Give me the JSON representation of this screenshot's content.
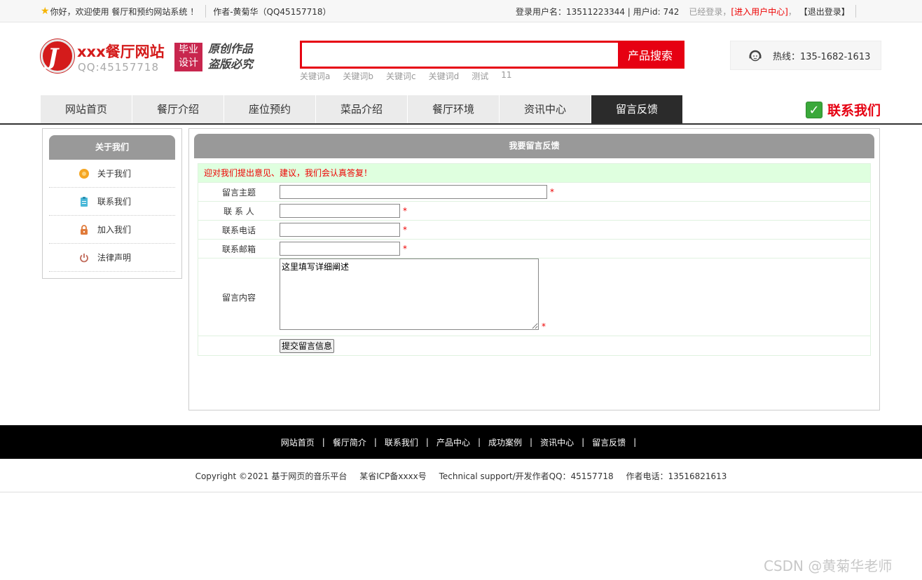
{
  "topbar": {
    "welcome": "你好，欢迎使用 餐厅和预约网站系统 ！",
    "author": "作者-黄菊华（QQ45157718）",
    "login_info": "登录用户名：13511223344 | 用户id: 742",
    "logged_in": "已经登录，",
    "user_center": "[进入用户中心]",
    "comma": "，",
    "logout": "【退出登录】"
  },
  "header": {
    "logo_letter": "J",
    "site_title": "xxx餐厅网站",
    "site_qq": "QQ:45157718",
    "grad_line1": "毕业",
    "grad_line2": "设计",
    "slogan_line1": "原创作品",
    "slogan_line2": "盗版必究",
    "search": {
      "value": "",
      "button": "产品搜索"
    },
    "keywords": [
      "关键词a",
      "关键词b",
      "关键词c",
      "关键词d",
      "测试",
      "11"
    ],
    "hotline": "热线：135-1682-1613"
  },
  "nav": {
    "items": [
      "网站首页",
      "餐厅介绍",
      "座位预约",
      "菜品介绍",
      "餐厅环境",
      "资讯中心",
      "留言反馈"
    ],
    "active_index": 6,
    "contact": "联系我们"
  },
  "sidebar": {
    "title": "关于我们",
    "items": [
      {
        "label": "关于我们",
        "icon": "orange-circle-icon"
      },
      {
        "label": "联系我们",
        "icon": "clipboard-icon"
      },
      {
        "label": "加入我们",
        "icon": "lock-icon"
      },
      {
        "label": "法律声明",
        "icon": "power-icon"
      }
    ]
  },
  "feedback": {
    "title": "我要留言反馈",
    "notice": "迎对我们提出意见、建议，我们会认真答复！",
    "subject_label": "留言主题",
    "contact_label": "联 系 人",
    "phone_label": "联系电话",
    "email_label": "联系邮箱",
    "content_label": "留言内容",
    "content_value": "这里填写详细阐述",
    "required_mark": "*",
    "submit": "提交留言信息"
  },
  "footer": {
    "links": [
      "网站首页",
      "餐厅简介",
      "联系我们",
      "产品中心",
      "成功案例",
      "资讯中心",
      "留言反馈"
    ],
    "separator": "|",
    "copyright": "Copyright ©2021 基于网页的音乐平台",
    "icp": "某省ICP备xxxx号",
    "support": "Technical support/开发作者QQ：45157718",
    "phone": "作者电话：13516821613"
  },
  "watermark": "CSDN @黄菊华老师",
  "colors": {
    "brand_red": "#e60012",
    "nav_active": "#2b2b2b",
    "panel_head": "#999999",
    "notice_bg": "#dfffdf"
  }
}
